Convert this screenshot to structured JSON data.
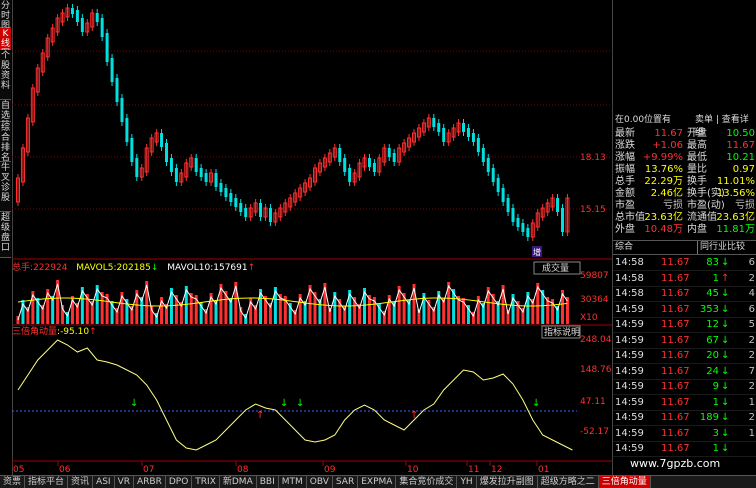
{
  "sidebar": {
    "tabs": [
      {
        "label": "分时图",
        "active": false
      },
      {
        "label": "K线图",
        "active": true
      },
      {
        "label": "个股资料",
        "active": false
      },
      {
        "label": "自选股",
        "active": false
      },
      {
        "label": "综合排名",
        "active": false
      },
      {
        "label": "牛叉诊股",
        "active": false
      },
      {
        "label": "超级盘口",
        "active": false
      }
    ]
  },
  "main_chart": {
    "price_labels": [
      "18.13",
      "15.15"
    ],
    "badge": "增"
  },
  "volume_panel": {
    "header_prefix": "总手",
    "total": "222924",
    "ma5_label": "MAVOL5",
    "ma5": "202185",
    "ma10_label": "MAVOL10",
    "ma10": "157691",
    "ma5_arrow": "↓",
    "ma10_arrow": "↑",
    "button": "成交量",
    "axis_labels": [
      "59807",
      "30364",
      "X10"
    ]
  },
  "indicator_panel": {
    "name": "三倍角动量",
    "value": "-95.10",
    "arrow": "↑",
    "button": "指标说明",
    "axis_labels": [
      "248.04",
      "148.76",
      "47.11",
      "-52.17"
    ]
  },
  "date_axis": [
    "05",
    "06",
    "07",
    "08",
    "09",
    "10",
    "11",
    "12",
    "01"
  ],
  "quote": {
    "header_left": "在0.00位置有",
    "header_right": "卖单 | 查看详细",
    "rows": [
      {
        "l": "最新",
        "lv": "11.67",
        "r": "开盘",
        "rv": "10.50",
        "lc": "#ff3030",
        "rc": "#00ff00"
      },
      {
        "l": "涨跌",
        "lv": "+1.06",
        "r": "最高",
        "rv": "11.67",
        "lc": "#ff3030",
        "rc": "#ff3030"
      },
      {
        "l": "涨幅",
        "lv": "+9.99%",
        "r": "最低",
        "rv": "10.21",
        "lc": "#ff3030",
        "rc": "#00ff00"
      },
      {
        "l": "振幅",
        "lv": "13.76%",
        "r": "量比",
        "rv": "0.97",
        "lc": "#ffff00",
        "rc": "#ffff00"
      },
      {
        "l": "总手",
        "lv": "22.29万",
        "r": "换手",
        "rv": "11.01%",
        "lc": "#ffff00",
        "rc": "#ffff00"
      },
      {
        "l": "金额",
        "lv": "2.46亿",
        "r": "换手(实)",
        "rv": "13.56%",
        "lc": "#ffff00",
        "rc": "#ffff00"
      },
      {
        "l": "市盈",
        "lv": "亏损",
        "r": "市盈(动)",
        "rv": "亏损",
        "lc": "#c0c0c0",
        "rc": "#c0c0c0"
      },
      {
        "l": "总市值",
        "lv": "23.63亿",
        "r": "流通值",
        "rv": "23.63亿",
        "lc": "#ffff00",
        "rc": "#ffff00"
      },
      {
        "l": "外盘",
        "lv": "10.48万",
        "r": "内盘",
        "rv": "11.81万",
        "lc": "#ff3030",
        "rc": "#00ff00"
      }
    ],
    "tab_left": "综合",
    "tab_right": "同行业比较"
  },
  "trades": [
    {
      "time": "14:58",
      "price": "11.67",
      "vol": "83",
      "dir": "↓",
      "dcolor": "#00ff00",
      "flag": "6"
    },
    {
      "time": "14:58",
      "price": "11.67",
      "vol": "1",
      "dir": "↑",
      "dcolor": "#ff3030",
      "flag": "2"
    },
    {
      "time": "14:58",
      "price": "11.67",
      "vol": "45",
      "dir": "↓",
      "dcolor": "#00ff00",
      "flag": "4"
    },
    {
      "time": "14:59",
      "price": "11.67",
      "vol": "353",
      "dir": "↓",
      "dcolor": "#00ff00",
      "flag": "6"
    },
    {
      "time": "14:59",
      "price": "11.67",
      "vol": "12",
      "dir": "↓",
      "dcolor": "#00ff00",
      "flag": "5"
    },
    {
      "time": "14:59",
      "price": "11.67",
      "vol": "67",
      "dir": "↓",
      "dcolor": "#00ff00",
      "flag": "2"
    },
    {
      "time": "14:59",
      "price": "11.67",
      "vol": "20",
      "dir": "↓",
      "dcolor": "#00ff00",
      "flag": "2"
    },
    {
      "time": "14:59",
      "price": "11.67",
      "vol": "24",
      "dir": "↓",
      "dcolor": "#00ff00",
      "flag": "7"
    },
    {
      "time": "14:59",
      "price": "11.67",
      "vol": "9",
      "dir": "↓",
      "dcolor": "#00ff00",
      "flag": "2"
    },
    {
      "time": "14:59",
      "price": "11.67",
      "vol": "1",
      "dir": "↓",
      "dcolor": "#00ff00",
      "flag": "1"
    },
    {
      "time": "14:59",
      "price": "11.67",
      "vol": "189",
      "dir": "↓",
      "dcolor": "#00ff00",
      "flag": "2"
    },
    {
      "time": "14:59",
      "price": "11.67",
      "vol": "3",
      "dir": "↓",
      "dcolor": "#00ff00",
      "flag": "1"
    },
    {
      "time": "14:59",
      "price": "11.67",
      "vol": "1",
      "dir": "↓",
      "dcolor": "#00ff00",
      "flag": ""
    }
  ],
  "bottom_tabs": [
    {
      "label": "资票",
      "active": false
    },
    {
      "label": "指标平台",
      "active": false
    },
    {
      "label": "资讯",
      "active": false
    },
    {
      "label": "ASI",
      "active": false
    },
    {
      "label": "VR",
      "active": false
    },
    {
      "label": "ARBR",
      "active": false
    },
    {
      "label": "DPO",
      "active": false
    },
    {
      "label": "TRIX",
      "active": false
    },
    {
      "label": "新DMA",
      "active": false
    },
    {
      "label": "BBI",
      "active": false
    },
    {
      "label": "MTM",
      "active": false
    },
    {
      "label": "OBV",
      "active": false
    },
    {
      "label": "SAR",
      "active": false
    },
    {
      "label": "EXPMA",
      "active": false
    },
    {
      "label": "集合竞价成交",
      "active": false
    },
    {
      "label": "YH",
      "active": false
    },
    {
      "label": "爆发拉升副图",
      "active": false
    },
    {
      "label": "超级方略之二",
      "active": false
    },
    {
      "label": "三倍角动量",
      "active": true
    }
  ],
  "watermark": "www.7gpzb.com"
}
